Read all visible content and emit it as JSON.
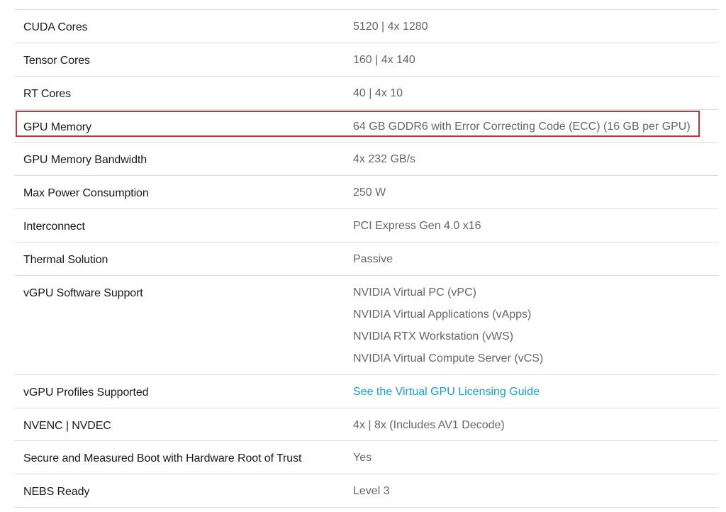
{
  "specs": [
    {
      "label": "CUDA Cores",
      "value": "5120 | 4x 1280"
    },
    {
      "label": "Tensor Cores",
      "value": "160 | 4x 140"
    },
    {
      "label": "RT Cores",
      "value": "40 | 4x 10"
    },
    {
      "label": "GPU Memory",
      "value": "64 GB GDDR6 with Error Correcting Code (ECC) (16 GB per GPU)"
    },
    {
      "label": "GPU Memory Bandwidth",
      "value": "4x 232 GB/s"
    },
    {
      "label": "Max Power Consumption",
      "value": "250 W"
    },
    {
      "label": "Interconnect",
      "value": "PCI Express Gen 4.0 x16"
    },
    {
      "label": "Thermal Solution",
      "value": "Passive"
    },
    {
      "label": "vGPU Software Support",
      "values": [
        "NVIDIA Virtual PC (vPC)",
        "NVIDIA Virtual Applications (vApps)",
        "NVIDIA RTX Workstation (vWS)",
        "NVIDIA Virtual Compute Server (vCS)"
      ]
    },
    {
      "label": "vGPU Profiles Supported",
      "link": "See the Virtual GPU Licensing Guide"
    },
    {
      "label": "NVENC | NVDEC",
      "value": "4x | 8x (Includes AV1 Decode)"
    },
    {
      "label": "Secure and Measured Boot with Hardware Root of Trust",
      "value": "Yes"
    },
    {
      "label": "NEBS Ready",
      "value": "Level 3"
    }
  ],
  "colors": {
    "label_text": "#1a1a1a",
    "value_text": "#666666",
    "link": "#1a9ed0",
    "divider": "#dcdcdc",
    "highlight_border": "#c4363f"
  }
}
